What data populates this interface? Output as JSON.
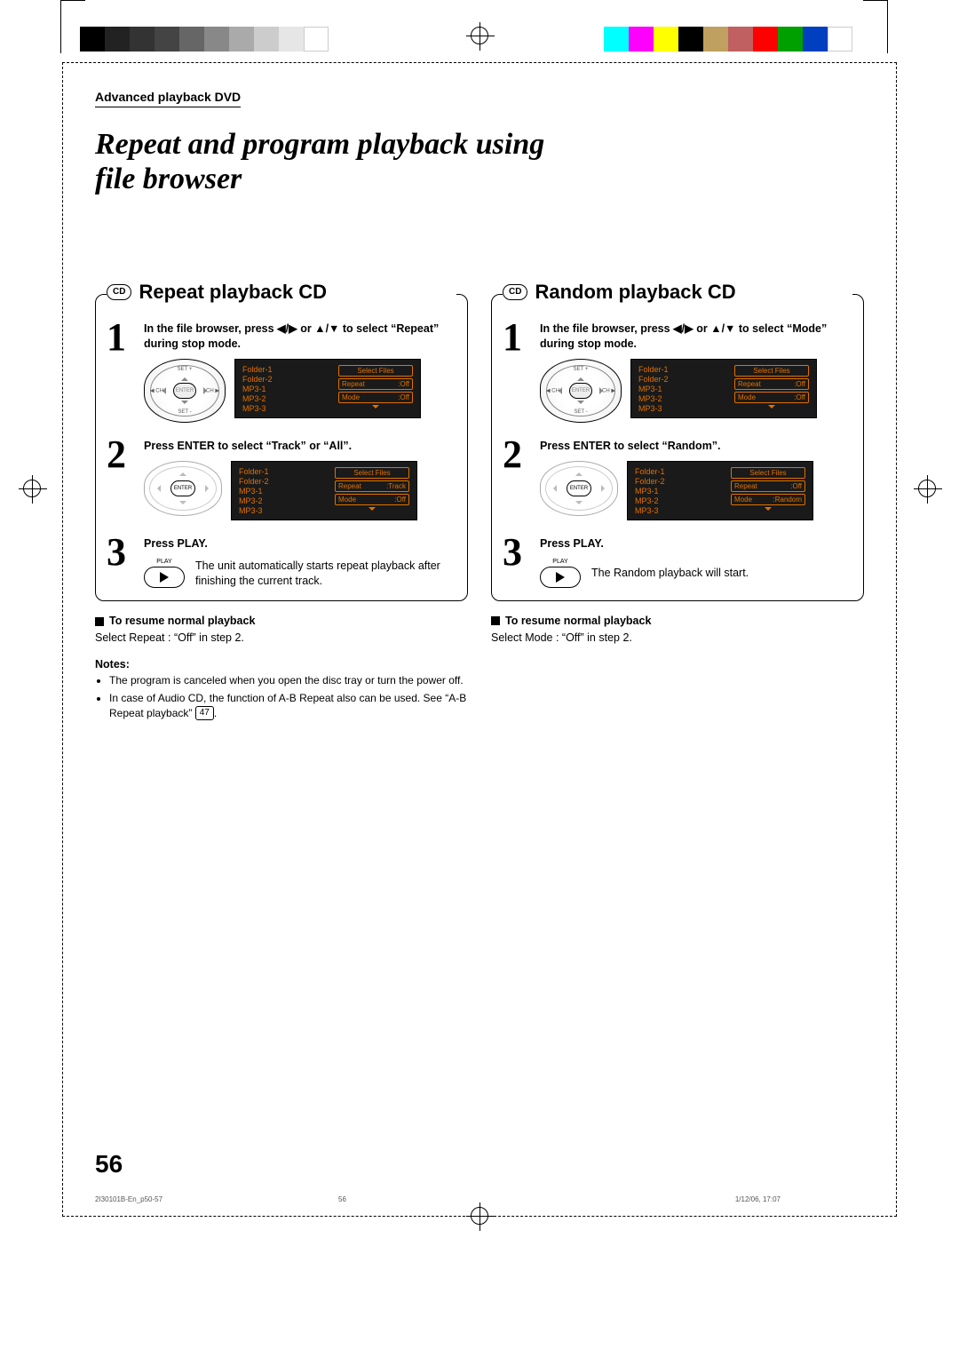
{
  "breadcrumb": "Advanced playback DVD",
  "page_title": "Repeat and program playback using file browser",
  "cd_badge": "CD",
  "page_number": "56",
  "footer": {
    "left": "2I30101B-En_p50-57",
    "mid": "56",
    "right": "1/12/06, 17:07"
  },
  "left": {
    "heading": "Repeat playback CD",
    "steps": [
      {
        "num": "1",
        "title": "In the file browser, press ◀/▶ or ▲/▼ to select “Repeat” during stop mode.",
        "remote": {
          "center": "ENTER",
          "top": "SET +",
          "bottom": "SET -",
          "l": "◀ CH",
          "r": "CH ▶"
        },
        "osd": {
          "list": [
            "Folder-1",
            "Folder-2",
            "MP3-1",
            "MP3-2",
            "MP3-3"
          ],
          "select_label": "Select Files",
          "rows": [
            {
              "label": "Repeat",
              "value": ":Off"
            },
            {
              "label": "Mode",
              "value": ":Off"
            }
          ]
        }
      },
      {
        "num": "2",
        "title": "Press ENTER to select “Track” or “All”.",
        "remote": {
          "center": "ENTER"
        },
        "osd": {
          "list": [
            "Folder-1",
            "Folder-2",
            "MP3-1",
            "MP3-2",
            "MP3-3"
          ],
          "select_label": "Select Files",
          "rows": [
            {
              "label": "Repeat",
              "value": ":Track"
            },
            {
              "label": "Mode",
              "value": ":Off"
            }
          ]
        }
      },
      {
        "num": "3",
        "title": "Press PLAY.",
        "play_label": "PLAY",
        "explain": "The unit automatically starts repeat playback after finishing the current track."
      }
    ],
    "resume_head": "To resume normal playback",
    "resume_text": "Select Repeat : “Off” in step 2.",
    "notes_head": "Notes:",
    "notes": [
      "The program is canceled when you open the disc tray or turn the power off.",
      "In case of Audio CD, the function of A-B Repeat also can be used. See “A-B Repeat playback”"
    ],
    "page_ref": "47"
  },
  "right": {
    "heading": "Random playback CD",
    "steps": [
      {
        "num": "1",
        "title": "In the file browser, press ◀/▶ or ▲/▼ to select “Mode” during stop mode.",
        "remote": {
          "center": "ENTER",
          "top": "SET +",
          "bottom": "SET -",
          "l": "◀ CH",
          "r": "CH ▶"
        },
        "osd": {
          "list": [
            "Folder-1",
            "Folder-2",
            "MP3-1",
            "MP3-2",
            "MP3-3"
          ],
          "select_label": "Select Files",
          "rows": [
            {
              "label": "Repeat",
              "value": ":Off"
            },
            {
              "label": "Mode",
              "value": ":Off"
            }
          ]
        }
      },
      {
        "num": "2",
        "title": "Press ENTER to select “Random”.",
        "remote": {
          "center": "ENTER"
        },
        "osd": {
          "list": [
            "Folder-1",
            "Folder-2",
            "MP3-1",
            "MP3-2",
            "MP3-3"
          ],
          "select_label": "Select Files",
          "rows": [
            {
              "label": "Repeat",
              "value": ":Off"
            },
            {
              "label": "Mode",
              "value": ":Random"
            }
          ]
        }
      },
      {
        "num": "3",
        "title": "Press PLAY.",
        "play_label": "PLAY",
        "explain": "The Random playback will start."
      }
    ],
    "resume_head": "To resume normal playback",
    "resume_text": "Select Mode : “Off” in step 2."
  }
}
